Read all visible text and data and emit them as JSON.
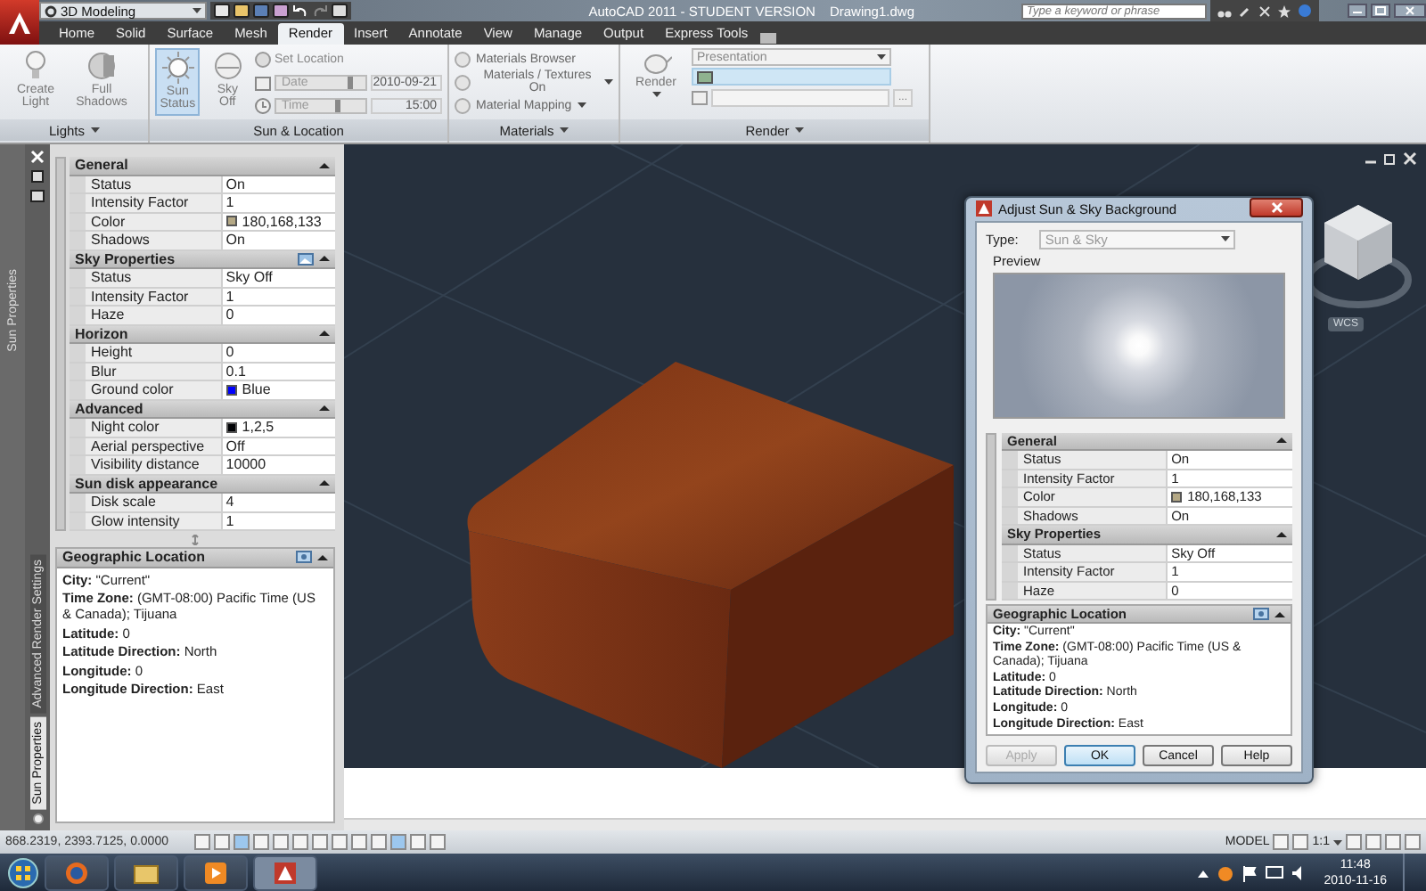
{
  "title_bar": {
    "workspace": "3D Modeling",
    "app_title": "AutoCAD 2011 - STUDENT VERSION",
    "document": "Drawing1.dwg",
    "search": {
      "placeholder": "Type a keyword or phrase"
    }
  },
  "ribbon_tabs": [
    {
      "label": "Home",
      "selected": false
    },
    {
      "label": "Solid",
      "selected": false
    },
    {
      "label": "Surface",
      "selected": false
    },
    {
      "label": "Mesh",
      "selected": false
    },
    {
      "label": "Render",
      "selected": true
    },
    {
      "label": "Insert",
      "selected": false
    },
    {
      "label": "Annotate",
      "selected": false
    },
    {
      "label": "View",
      "selected": false
    },
    {
      "label": "Manage",
      "selected": false
    },
    {
      "label": "Output",
      "selected": false
    },
    {
      "label": "Express Tools",
      "selected": false
    }
  ],
  "ribbon": {
    "lights": {
      "title": "Lights",
      "buttons": [
        {
          "label": "Create Light"
        },
        {
          "label": "Full Shadows"
        }
      ]
    },
    "sun_location": {
      "title": "Sun & Location",
      "buttons": [
        {
          "label": "Sun Status",
          "selected": true
        },
        {
          "label": "Sky Off",
          "selected": false
        }
      ],
      "set_location": "Set Location",
      "date": {
        "label": "Date",
        "value": "2010-09-21",
        "level": 0.8
      },
      "time": {
        "label": "Time",
        "value": "15:00",
        "level": 0.65
      }
    },
    "materials": {
      "title": "Materials",
      "items": [
        {
          "label": "Materials Browser",
          "dropdown": false
        },
        {
          "label": "Materials / Textures On",
          "dropdown": true
        },
        {
          "label": "Material Mapping",
          "dropdown": true
        }
      ]
    },
    "render": {
      "title": "Render",
      "button": "Render",
      "preset": "Presentation",
      "browse": "..."
    }
  },
  "palette": {
    "title": "Sun Properties",
    "tabs": [
      {
        "label": "Advanced Render Settings",
        "selected": false
      },
      {
        "label": "Sun Properties",
        "selected": true
      }
    ],
    "sections": [
      {
        "title": "General",
        "tool_icon": false,
        "rows": [
          {
            "name": "Status",
            "value": "On"
          },
          {
            "name": "Intensity Factor",
            "value": "1"
          },
          {
            "name": "Color",
            "value": "180,168,133",
            "color": "#b4a885"
          },
          {
            "name": "Shadows",
            "value": "On"
          }
        ]
      },
      {
        "title": "Sky Properties",
        "tool_icon": true,
        "rows": [
          {
            "name": "Status",
            "value": "Sky Off"
          },
          {
            "name": "Intensity Factor",
            "value": "1"
          },
          {
            "name": "Haze",
            "value": "0"
          }
        ]
      },
      {
        "title": "Horizon",
        "tool_icon": false,
        "rows": [
          {
            "name": "Height",
            "value": "0"
          },
          {
            "name": "Blur",
            "value": "0.1"
          },
          {
            "name": "Ground color",
            "value": "Blue",
            "color": "#0000ff"
          }
        ]
      },
      {
        "title": "Advanced",
        "tool_icon": false,
        "rows": [
          {
            "name": "Night color",
            "value": "1,2,5",
            "color": "#010205"
          },
          {
            "name": "Aerial perspective",
            "value": "Off"
          },
          {
            "name": "Visibility distance",
            "value": "10000"
          }
        ]
      },
      {
        "title": "Sun disk appearance",
        "tool_icon": false,
        "rows": [
          {
            "name": "Disk scale",
            "value": "4"
          },
          {
            "name": "Glow intensity",
            "value": "1"
          }
        ]
      }
    ],
    "geo": {
      "title": "Geographic Location",
      "lines": [
        "**City:** \"Current\"",
        "**Time Zone:** (GMT-08:00) Pacific Time (US & Canada); Tijuana",
        "**Latitude:** 0",
        "**Latitude Direction:** North",
        "**Longitude:** 0",
        "**Longitude Direction:** East"
      ]
    }
  },
  "viewport": {
    "cube_label": "WCS"
  },
  "dialog": {
    "title": "Adjust Sun & Sky Background",
    "type_label": "Type:",
    "type_value": "Sun & Sky",
    "preview_label": "Preview",
    "sections": [
      {
        "title": "General",
        "tool_icon": false,
        "rows": [
          {
            "name": "Status",
            "value": "On"
          },
          {
            "name": "Intensity Factor",
            "value": "1"
          },
          {
            "name": "Color",
            "value": "180,168,133",
            "color": "#b4a885"
          },
          {
            "name": "Shadows",
            "value": "On"
          }
        ]
      },
      {
        "title": "Sky Properties",
        "tool_icon": false,
        "rows": [
          {
            "name": "Status",
            "value": "Sky Off"
          },
          {
            "name": "Intensity Factor",
            "value": "1"
          },
          {
            "name": "Haze",
            "value": "0"
          }
        ]
      }
    ],
    "geo": {
      "title": "Geographic Location",
      "lines": [
        "**City:** \"Current\"",
        "**Time Zone:** (GMT-08:00) Pacific Time (US & Canada); Tijuana",
        "**Latitude:** 0",
        "**Latitude Direction:** North",
        "**Longitude:** 0",
        "**Longitude Direction:** East"
      ]
    },
    "buttons": [
      {
        "label": "Apply",
        "disabled": true,
        "default": false
      },
      {
        "label": "OK",
        "disabled": false,
        "default": true
      },
      {
        "label": "Cancel",
        "disabled": false,
        "default": false
      },
      {
        "label": "Help",
        "disabled": false,
        "default": false
      }
    ]
  },
  "status_bar": {
    "coordinates": "868.2319, 2393.7125, 0.0000",
    "space": "MODEL",
    "scale": "1:1"
  },
  "taskbar": {
    "time": "11:48",
    "date": "2010-11-16"
  }
}
